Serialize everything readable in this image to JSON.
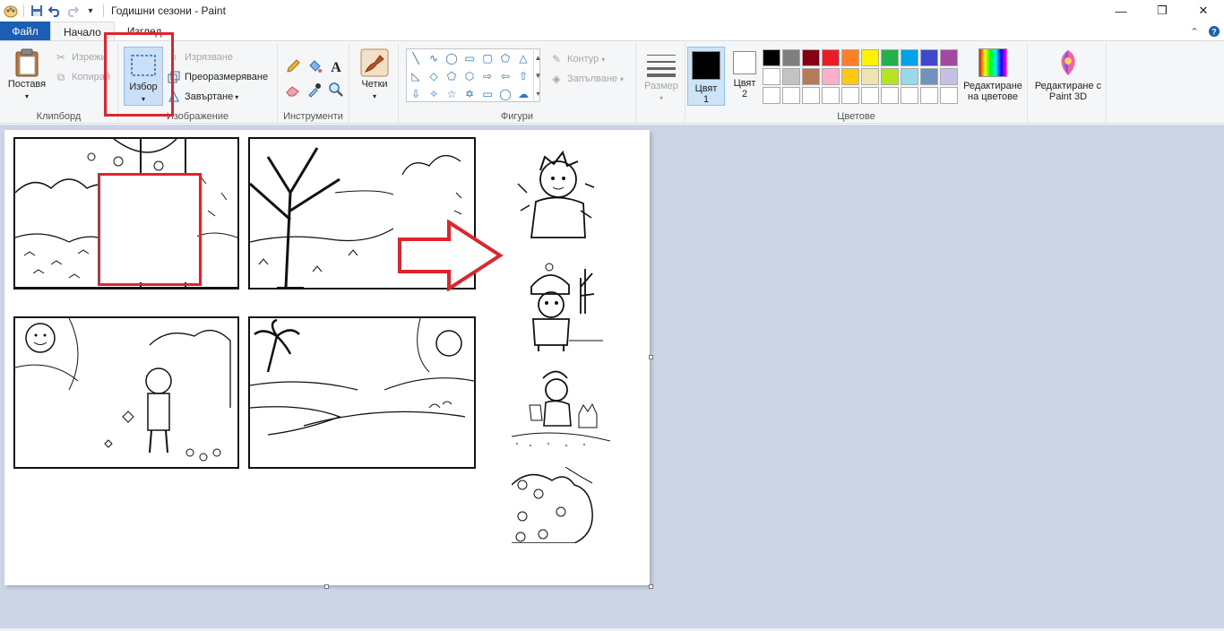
{
  "window": {
    "title": "Годишни сезони - Paint",
    "minimize_glyph": "—",
    "restore_glyph": "❐",
    "close_glyph": "✕"
  },
  "tabs": {
    "file": "Файл",
    "home": "Начало",
    "view": "Изглед"
  },
  "clipboard": {
    "paste": "Поставя",
    "cut": "Изрежи",
    "copy": "Копирай",
    "label": "Клипборд"
  },
  "image": {
    "select": "Избор",
    "crop": "Изрязване",
    "resize": "Преоразмеряване",
    "rotate": "Завъртане",
    "label": "Изображение"
  },
  "tools": {
    "label": "Инструменти"
  },
  "brushes": {
    "label": "Четки"
  },
  "shapes": {
    "outline": "Контур",
    "fill": "Запълване",
    "label": "Фигури"
  },
  "size": {
    "label": "Размер"
  },
  "colors": {
    "color1": "Цвят 1",
    "color2": "Цвят 2",
    "edit": "Редактиране на цветове",
    "paint3d": "Редактиране с Paint 3D",
    "label": "Цветове",
    "color1_value": "#000000",
    "color2_value": "#ffffff",
    "palette_row1": [
      "#000000",
      "#7f7f7f",
      "#880015",
      "#ed1c24",
      "#ff7f27",
      "#fff200",
      "#22b14c",
      "#00a2e8",
      "#3f48cc",
      "#a349a4"
    ],
    "palette_row2": [
      "#ffffff",
      "#c3c3c3",
      "#b97a57",
      "#ffaec9",
      "#ffc90e",
      "#efe4b0",
      "#b5e61d",
      "#99d9ea",
      "#7092be",
      "#c8bfe7"
    ],
    "palette_row3": [
      "#ffffff",
      "#ffffff",
      "#ffffff",
      "#ffffff",
      "#ffffff",
      "#ffffff",
      "#ffffff",
      "#ffffff",
      "#ffffff",
      "#ffffff"
    ]
  },
  "accents": {
    "annotation_red": "#e0242b",
    "file_tab_blue": "#1a5fb4",
    "workspace_bg": "#cbd5e6"
  }
}
